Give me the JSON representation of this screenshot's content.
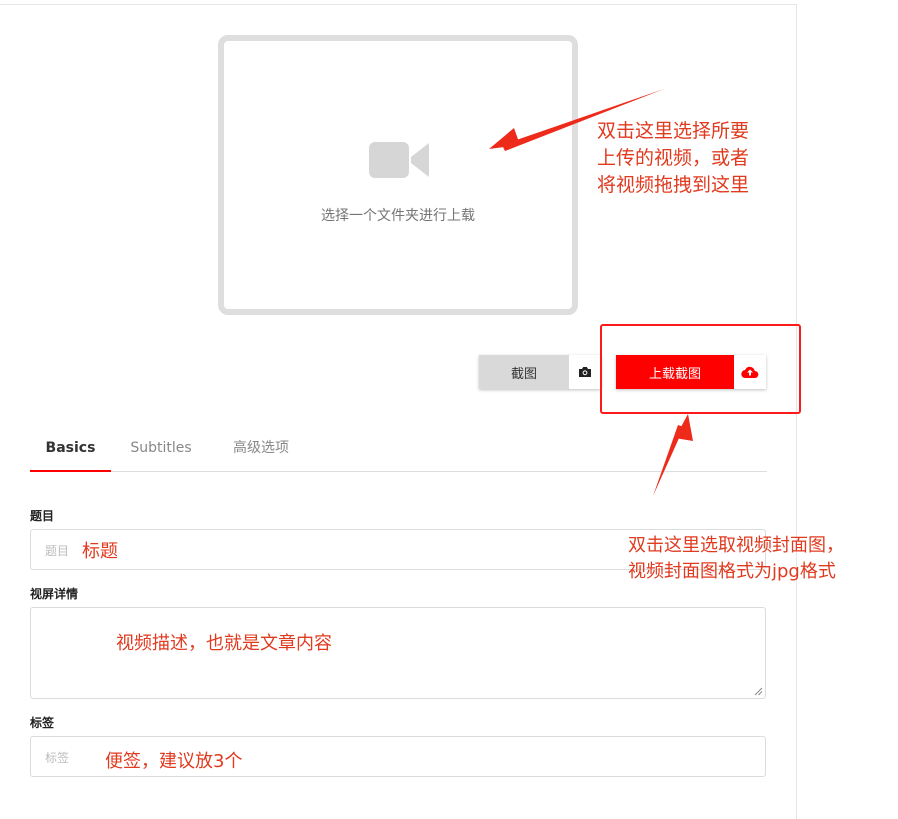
{
  "upload": {
    "dropzone_text": "选择一个文件夹进行上载",
    "snapshot_label": "截图",
    "upload_cover_label": "上载截图"
  },
  "tabs": [
    {
      "label": "Basics",
      "active": true
    },
    {
      "label": "Subtitles",
      "active": false
    },
    {
      "label": "高级选项",
      "active": false
    }
  ],
  "form": {
    "title_label": "题目",
    "title_placeholder": "题目",
    "details_label": "视屏详情",
    "tags_label": "标签",
    "tags_placeholder": "标签"
  },
  "annotations": {
    "dropzone_note": [
      "双击这里选择所要",
      "上传的视频，或者",
      "将视频拖拽到这里"
    ],
    "cover_note": [
      "双击这里选取视频封面图，",
      "视频封面图格式为jpg格式"
    ],
    "title_note": "标题",
    "details_note": "视频描述，也就是文章内容",
    "tags_note": "便签，建议放3个"
  },
  "colors": {
    "accent": "#ff0000",
    "annotation": "#e03a1f",
    "dropzone_border": "#dedede"
  },
  "icons": {
    "dropzone": "video-camera-icon",
    "snapshot": "camera-icon",
    "upload": "cloud-upload-icon"
  }
}
